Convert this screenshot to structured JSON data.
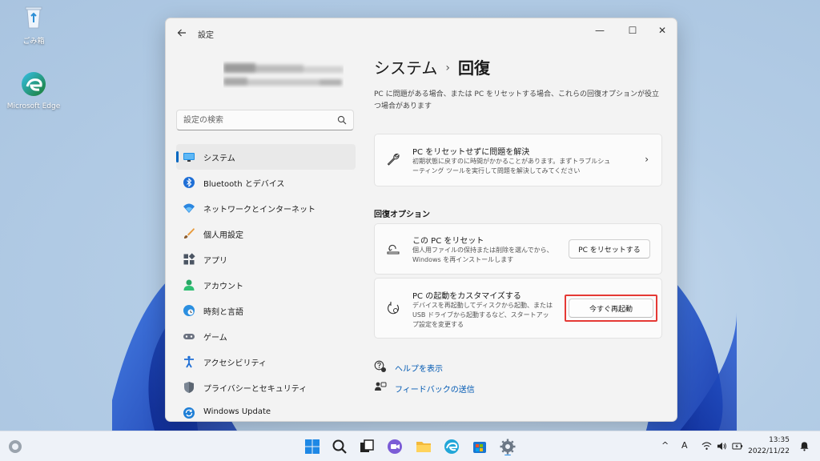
{
  "desktop": {
    "icons": [
      {
        "label": "ごみ箱"
      },
      {
        "label": "Microsoft Edge"
      }
    ]
  },
  "window": {
    "title": "設定",
    "controls": {
      "minimize": "—",
      "maximize": "☐",
      "close": "✕"
    }
  },
  "sidebar": {
    "search_placeholder": "設定の検索",
    "items": [
      {
        "label": "システム",
        "icon": "monitor-icon",
        "active": true
      },
      {
        "label": "Bluetooth とデバイス",
        "icon": "bluetooth-icon"
      },
      {
        "label": "ネットワークとインターネット",
        "icon": "wifi-icon"
      },
      {
        "label": "個人用設定",
        "icon": "brush-icon"
      },
      {
        "label": "アプリ",
        "icon": "apps-icon"
      },
      {
        "label": "アカウント",
        "icon": "person-icon"
      },
      {
        "label": "時刻と言語",
        "icon": "globe-clock-icon"
      },
      {
        "label": "ゲーム",
        "icon": "gamepad-icon"
      },
      {
        "label": "アクセシビリティ",
        "icon": "accessibility-icon"
      },
      {
        "label": "プライバシーとセキュリティ",
        "icon": "shield-icon"
      },
      {
        "label": "Windows Update",
        "icon": "update-icon"
      }
    ]
  },
  "main": {
    "breadcrumb_parent": "システム",
    "breadcrumb_separator": "›",
    "breadcrumb_current": "回復",
    "description": "PC に問題がある場合、または PC をリセットする場合、これらの回復オプションが役立つ場合があります",
    "troubleshoot_card": {
      "title": "PC をリセットせずに問題を解決",
      "desc": "初期状態に戻すのに時間がかかることがあります。まずトラブルシューティング ツールを実行して問題を解決してみてください",
      "chevron": "›"
    },
    "section_title": "回復オプション",
    "reset_card": {
      "title": "この PC をリセット",
      "desc": "個人用ファイルの保持または削除を選んでから、Windows を再インストールします",
      "button": "PC をリセットする"
    },
    "startup_card": {
      "title": "PC の起動をカスタマイズする",
      "desc": "デバイスを再起動してディスクから起動、または USB ドライブから起動するなど、スタートアップ設定を変更する",
      "button": "今すぐ再起動"
    },
    "links": [
      {
        "label": "ヘルプを表示",
        "icon": "help-icon"
      },
      {
        "label": "フィードバックの送信",
        "icon": "feedback-icon"
      }
    ]
  },
  "taskbar": {
    "ime": "A",
    "time": "13:35",
    "date": "2022/11/22"
  },
  "colors": {
    "accent": "#0067c0",
    "highlight_border": "#e53935",
    "link": "#0059b3"
  }
}
